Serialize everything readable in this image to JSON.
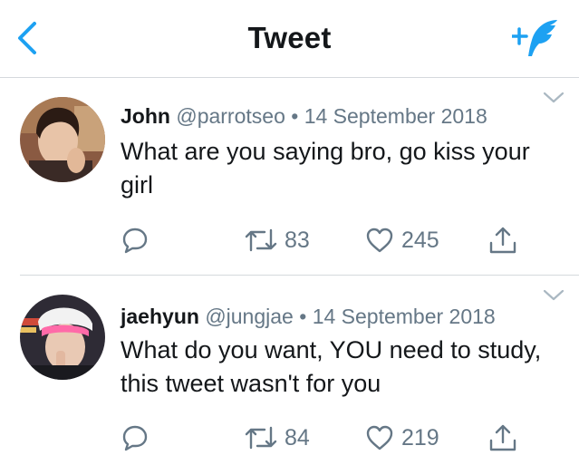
{
  "header": {
    "title": "Tweet",
    "accent_color": "#1da1f2"
  },
  "tweets": [
    {
      "name": "John",
      "handle": "@parrotseo",
      "separator": "•",
      "date": "14 September 2018",
      "text": "What are you saying bro, go kiss your girl",
      "retweets": "83",
      "likes": "245"
    },
    {
      "name": "jaehyun",
      "handle": "@jungjae",
      "separator": "•",
      "date": "14 September 2018",
      "text": "What do you want, YOU need to study, this tweet wasn't for you",
      "retweets": "84",
      "likes": "219"
    }
  ],
  "icons": {
    "back": "chevron-left-icon",
    "compose": "compose-tweet-icon",
    "menu": "chevron-down-icon",
    "reply": "reply-icon",
    "retweet": "retweet-icon",
    "like": "heart-icon",
    "share": "share-icon"
  }
}
